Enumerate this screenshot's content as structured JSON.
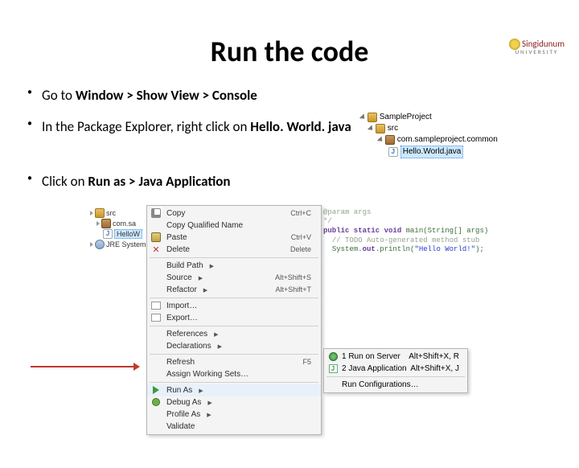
{
  "logo": {
    "name": "Singidunum",
    "sub": "UNIVERSITY"
  },
  "title": "Run the code",
  "bullets": {
    "b1_pre": "Go to ",
    "b1_strong": "Window > Show View > Console",
    "b2_plain": "In the Package Explorer, right click on ",
    "b2_strong": "Hello. World. java",
    "b3_pre": "Click on ",
    "b3_strong": "Run as > Java Application"
  },
  "explorer": {
    "project": "SampleProject",
    "src": "src",
    "pkg": "com.sampleproject.common",
    "file": "Hello.World.java"
  },
  "sidetree": {
    "src": "src",
    "pkg": "com.sa",
    "file": "HelloW",
    "lib": "JRE System Lib"
  },
  "code": {
    "l1": "@param args",
    "l2": "*/",
    "l3a": "public static void ",
    "l3b": "main(String[] args)",
    "l4": "// TODO Auto-generated method stub",
    "l5a": "System.",
    "l5b": "out",
    "l5c": ".println(",
    "l5d": "\"Hello World!\"",
    "l5e": ");"
  },
  "ctx": {
    "copy": "Copy",
    "copy_sc": "Ctrl+C",
    "copyq": "Copy Qualified Name",
    "paste": "Paste",
    "paste_sc": "Ctrl+V",
    "delete": "Delete",
    "delete_sc": "Delete",
    "build": "Build Path",
    "source": "Source",
    "source_sc": "Alt+Shift+S",
    "refactor": "Refactor",
    "refactor_sc": "Alt+Shift+T",
    "import": "Import…",
    "export": "Export…",
    "refs": "References",
    "decls": "Declarations",
    "refresh": "Refresh",
    "refresh_sc": "F5",
    "assign": "Assign Working Sets…",
    "runas": "Run As",
    "debugas": "Debug As",
    "profileas": "Profile As",
    "validate": "Validate"
  },
  "submenu": {
    "server": "1  Run on Server",
    "server_sc": "Alt+Shift+X, R",
    "java": "2  Java Application",
    "java_sc": "Alt+Shift+X, J",
    "config": "Run Configurations…"
  }
}
